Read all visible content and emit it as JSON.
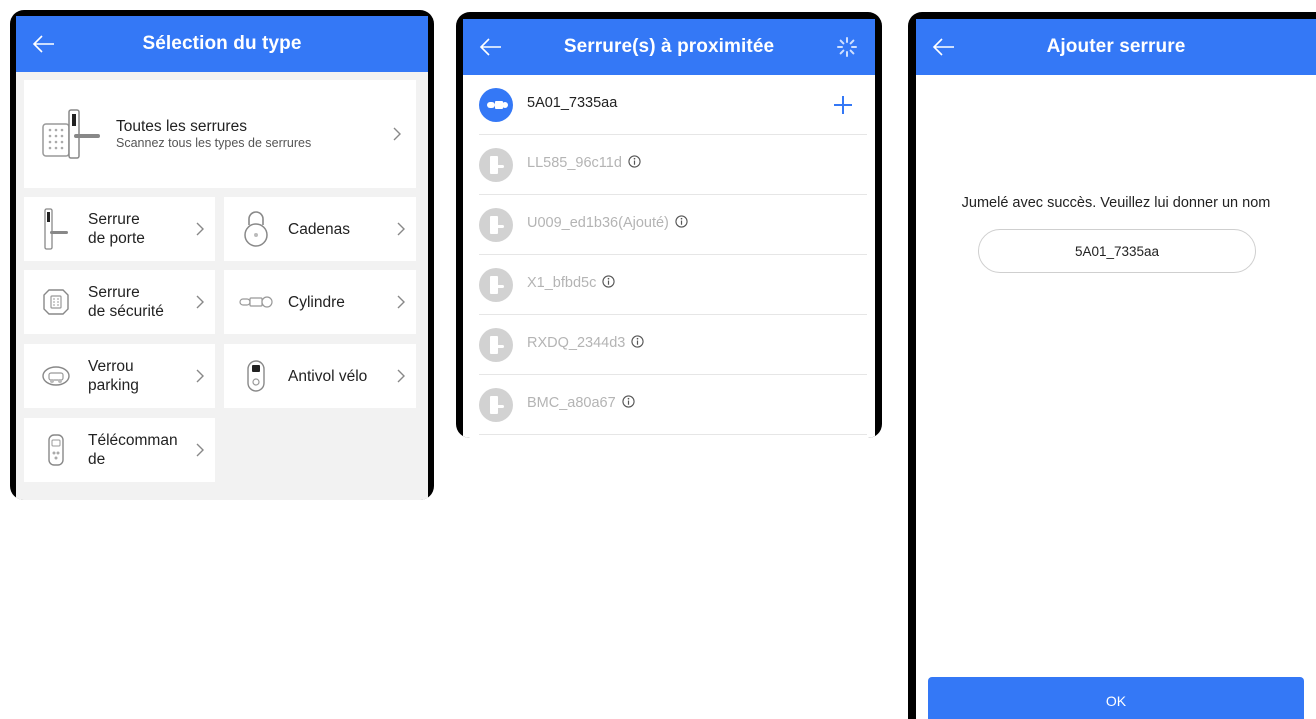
{
  "screen1": {
    "title": "Sélection du type",
    "all_locks": {
      "label": "Toutes les serrures",
      "sub": "Scannez tous les types de serrures"
    },
    "types": [
      {
        "l1": "Serrure",
        "l2": "de porte",
        "icon": "door-lock-icon"
      },
      {
        "l1": "Cadenas",
        "l2": "",
        "icon": "padlock-icon"
      },
      {
        "l1": "Serrure",
        "l2": "de sécurité",
        "icon": "safe-lock-icon"
      },
      {
        "l1": "Cylindre",
        "l2": "",
        "icon": "cylinder-icon"
      },
      {
        "l1": "Verrou",
        "l2": "parking",
        "icon": "parking-lock-icon"
      },
      {
        "l1": "Antivol vélo",
        "l2": "",
        "icon": "bike-lock-icon"
      },
      {
        "l1": "Télécomman",
        "l2": "de",
        "icon": "remote-control-icon"
      }
    ]
  },
  "screen2": {
    "title": "Serrure(s) à proximitée",
    "devices": [
      {
        "name": "5A01_7335aa",
        "active": true
      },
      {
        "name": "LL585_96c11d",
        "active": false
      },
      {
        "name": "U009_ed1b36(Ajouté)",
        "active": false
      },
      {
        "name": "X1_bfbd5c",
        "active": false
      },
      {
        "name": "RXDQ_2344d3",
        "active": false
      },
      {
        "name": "BMC_a80a67",
        "active": false
      }
    ]
  },
  "screen3": {
    "title": "Ajouter serrure",
    "message": "Jumelé avec succès. Veuillez lui donner un nom",
    "name_value": "5A01_7335aa",
    "ok_label": "OK"
  },
  "colors": {
    "accent": "#3478f6",
    "background_grey": "#f2f2f2",
    "dim_text": "#b4b4b4"
  }
}
